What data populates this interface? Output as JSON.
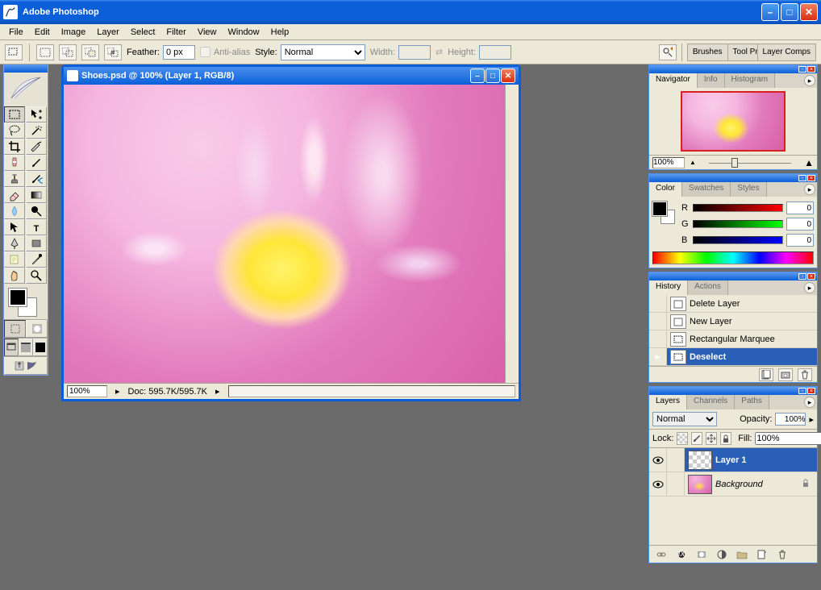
{
  "app": {
    "title": "Adobe Photoshop"
  },
  "menu": [
    "File",
    "Edit",
    "Image",
    "Layer",
    "Select",
    "Filter",
    "View",
    "Window",
    "Help"
  ],
  "options": {
    "feather_label": "Feather:",
    "feather_value": "0 px",
    "antialias_label": "Anti-alias",
    "style_label": "Style:",
    "style_value": "Normal",
    "width_label": "Width:",
    "height_label": "Height:"
  },
  "palette_well": {
    "brushes": "Brushes",
    "toolpresets": "Tool Presets",
    "layercomps": "Layer Comps"
  },
  "doc": {
    "title": "Shoes.psd @ 100% (Layer 1, RGB/8)",
    "zoom": "100%",
    "status": "Doc: 595.7K/595.7K"
  },
  "navigator": {
    "tabs": [
      "Navigator",
      "Info",
      "Histogram"
    ],
    "zoom": "100%"
  },
  "color": {
    "tabs": [
      "Color",
      "Swatches",
      "Styles"
    ],
    "r": "0",
    "g": "0",
    "b": "0",
    "r_label": "R",
    "g_label": "G",
    "b_label": "B"
  },
  "history": {
    "tabs": [
      "History",
      "Actions"
    ],
    "items": [
      {
        "label": "Delete Layer"
      },
      {
        "label": "New Layer"
      },
      {
        "label": "Rectangular Marquee"
      },
      {
        "label": "Deselect"
      }
    ]
  },
  "layers": {
    "tabs": [
      "Layers",
      "Channels",
      "Paths"
    ],
    "blend": "Normal",
    "opacity_label": "Opacity:",
    "opacity": "100%",
    "lock_label": "Lock:",
    "fill_label": "Fill:",
    "fill": "100%",
    "items": [
      {
        "name": "Layer 1",
        "active": true,
        "locked": false,
        "bg": false
      },
      {
        "name": "Background",
        "active": false,
        "locked": true,
        "bg": true
      }
    ]
  }
}
